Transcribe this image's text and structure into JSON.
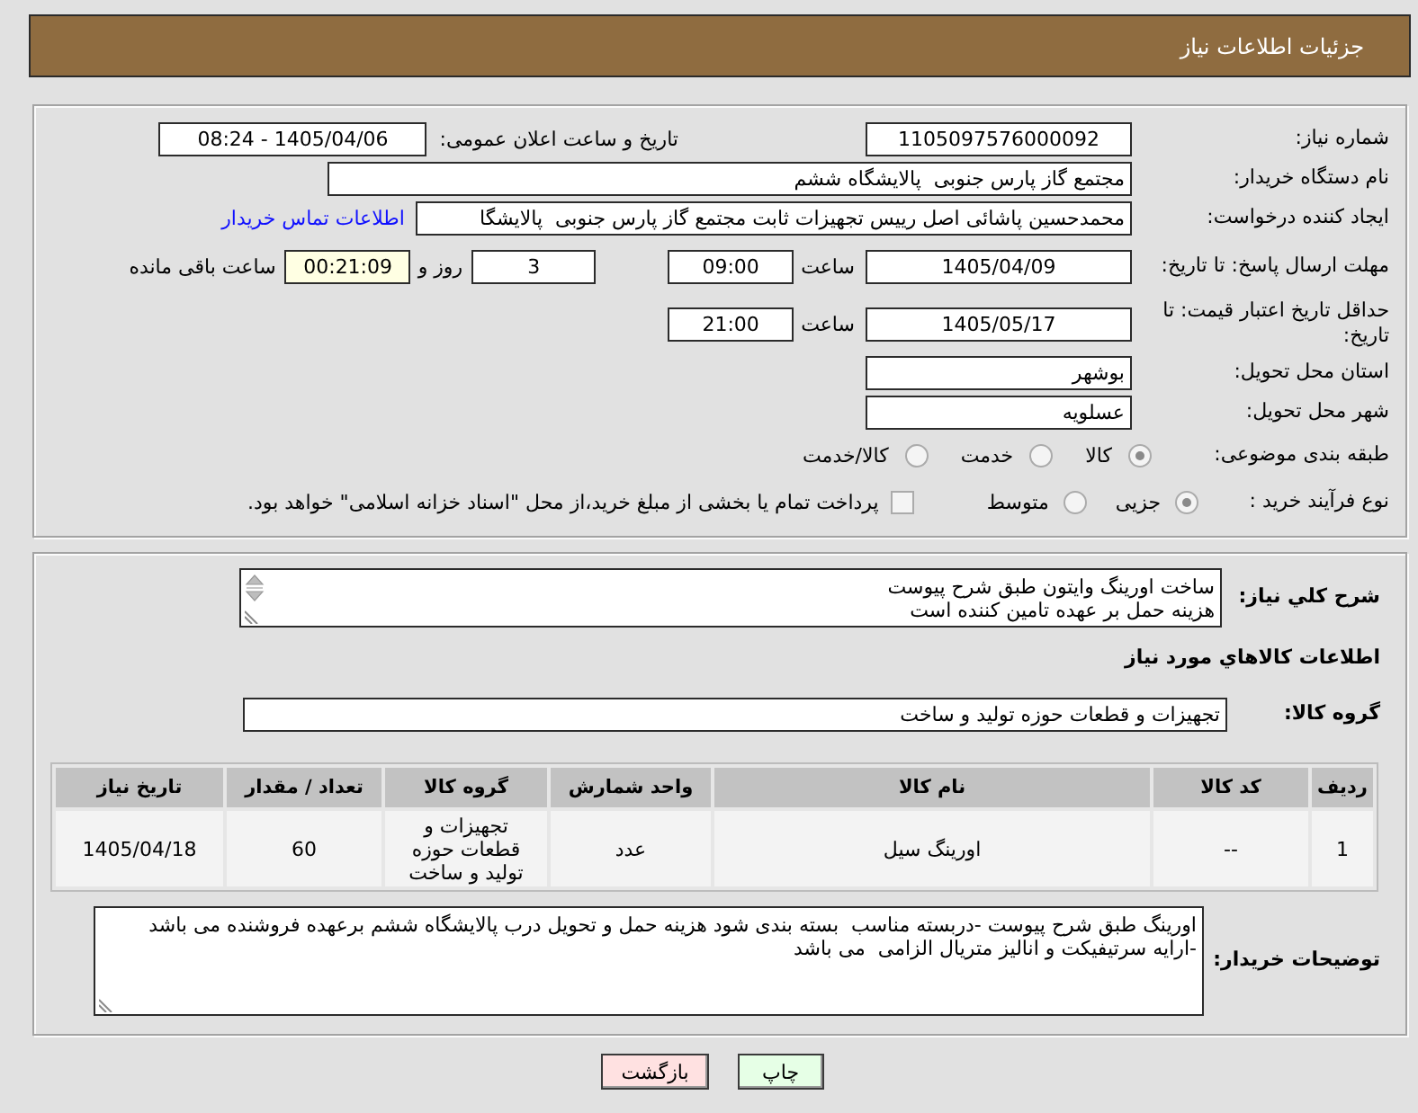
{
  "header": {
    "title": "جزئیات اطلاعات نیاز"
  },
  "details": {
    "need_number": {
      "label": "شماره نیاز:",
      "value": "1105097576000092"
    },
    "announce": {
      "label": "تاریخ و ساعت اعلان عمومی:",
      "value": "1405/04/06 - 08:24"
    },
    "buyer_org": {
      "label": "نام دستگاه خریدار:",
      "value": "مجتمع گاز پارس جنوبی  پالایشگاه ششم"
    },
    "requester": {
      "label": "ایجاد کننده درخواست:",
      "value": "محمدحسین پاشائی اصل رییس تجهیزات ثابت مجتمع گاز پارس جنوبی  پالایشگا",
      "link": "اطلاعات تماس خریدار"
    },
    "response_deadline": {
      "label": "مهلت ارسال پاسخ: تا تاریخ:",
      "date": "1405/04/09",
      "time_label": "ساعت",
      "time": "09:00",
      "days": "3",
      "days_label": "روز و",
      "remaining": "00:21:09",
      "remaining_label": "ساعت باقی مانده"
    },
    "price_validity": {
      "label": "حداقل تاریخ اعتبار قیمت: تا تاریخ:",
      "date": "1405/05/17",
      "time_label": "ساعت",
      "time": "21:00"
    },
    "province": {
      "label": "استان محل تحویل:",
      "value": "بوشهر"
    },
    "city": {
      "label": "شهر محل تحویل:",
      "value": "عسلویه"
    },
    "category": {
      "label": "طبقه بندی موضوعی:",
      "options": [
        {
          "label": "کالا",
          "selected": true
        },
        {
          "label": "خدمت",
          "selected": false
        },
        {
          "label": "کالا/خدمت",
          "selected": false
        }
      ]
    },
    "process": {
      "label": "نوع فرآیند خرید :",
      "options": [
        {
          "label": "جزیی",
          "selected": true
        },
        {
          "label": "متوسط",
          "selected": false
        }
      ],
      "treasury": {
        "label": "پرداخت تمام یا بخشی از مبلغ خرید،از محل \"اسناد خزانه اسلامی\" خواهد بود.",
        "checked": false
      }
    }
  },
  "needs": {
    "summary": {
      "label": "شرح کلي نياز:",
      "value": "ساخت اورینگ وایتون طبق شرح پیوست\nهزینه حمل بر عهده تامین کننده است"
    },
    "goods_title": "اطلاعات کالاهاي مورد نياز",
    "goods_group": {
      "label": "گروه کالا:",
      "value": "تجهیزات و قطعات حوزه تولید و ساخت"
    },
    "table": {
      "columns": [
        "ردیف",
        "کد کالا",
        "نام کالا",
        "واحد شمارش",
        "گروه کالا",
        "تعداد / مقدار",
        "تاریخ نیاز"
      ],
      "rows": [
        [
          "1",
          "--",
          "اورینگ سیل",
          "عدد",
          "تجهیزات و قطعات حوزه تولید و ساخت",
          "60",
          "1405/04/18"
        ]
      ]
    },
    "buyer_notes": {
      "label": "توضیحات خریدار:",
      "value": "اورینگ طبق شرح پیوست -دربسته مناسب  بسته بندی شود هزینه حمل و تحویل درب پالایشگاه ششم برعهده فروشنده می باشد -ارایه سرتیفیکت و انالیز متریال الزامی  می باشد"
    }
  },
  "buttons": [
    {
      "label": "چاپ",
      "kind": "print"
    },
    {
      "label": "بازگشت",
      "kind": "back"
    }
  ]
}
